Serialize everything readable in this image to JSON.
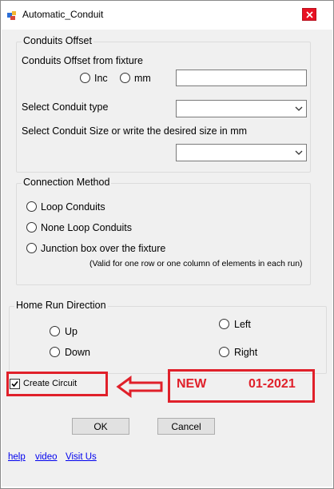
{
  "window": {
    "title": "Automatic_Conduit",
    "close_icon": "close-icon",
    "app_icon": "form-app-icon"
  },
  "offset": {
    "group_title": "Conduits Offset",
    "label": "Conduits Offset from fixture",
    "radio_inc": "Inc",
    "radio_mm": "mm",
    "value": ""
  },
  "conduit_type": {
    "label": "Select Conduit type",
    "selected": ""
  },
  "conduit_size": {
    "label": "Select Conduit Size or write the desired size in  mm",
    "selected": ""
  },
  "connection": {
    "group_title": "Connection Method",
    "options": [
      "Loop Conduits",
      "None Loop Conduits",
      "Junction box over the fixture"
    ],
    "note": "(Valid for one row or one column of elements in each run)"
  },
  "home_run": {
    "group_title": "Home Run Direction",
    "up": "Up",
    "down": "Down",
    "left": "Left",
    "right": "Right"
  },
  "create_circuit": {
    "label": "Create Circuit",
    "checked": true
  },
  "annotation": {
    "new_label": "NEW",
    "date": "01-2021",
    "color": "#e0202a"
  },
  "buttons": {
    "ok": "OK",
    "cancel": "Cancel"
  },
  "links": {
    "help": "help",
    "video": "video",
    "visit": "Visit Us"
  }
}
